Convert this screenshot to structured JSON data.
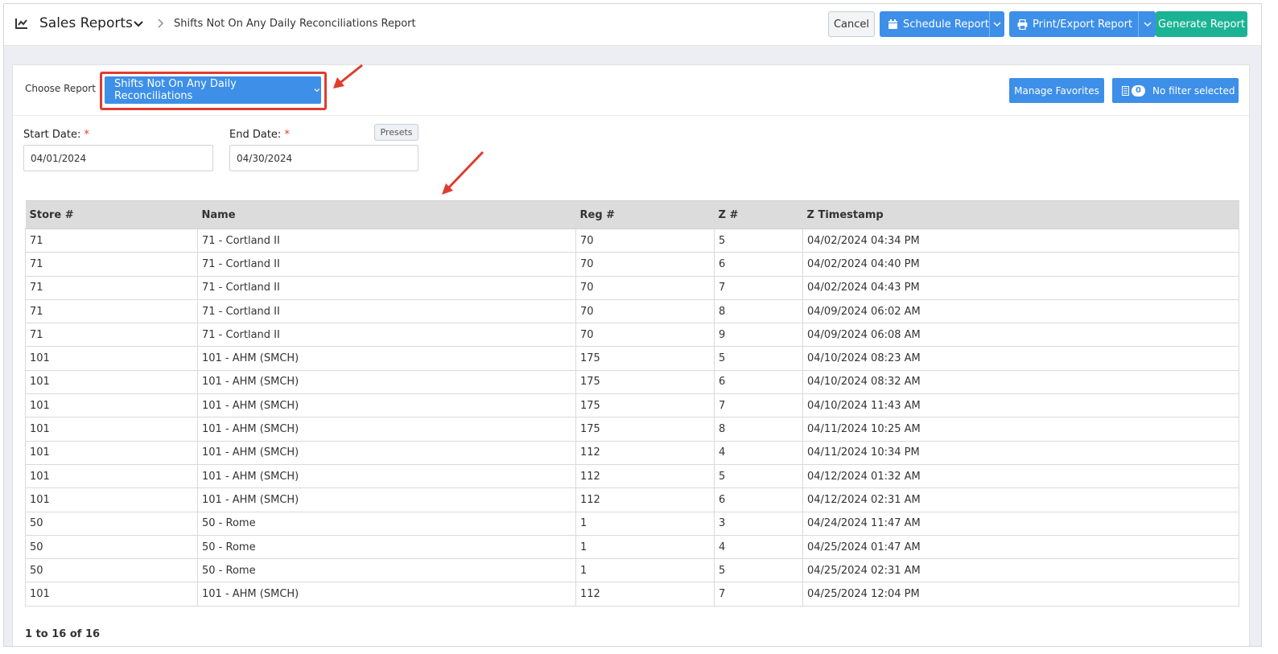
{
  "header": {
    "app_title": "Sales Reports",
    "breadcrumb": "Shifts Not On Any Daily Reconciliations Report",
    "cancel_label": "Cancel",
    "schedule_label": "Schedule Report",
    "print_label": "Print/Export Report",
    "generate_label": "Generate Report"
  },
  "controls": {
    "choose_report_label": "Choose Report",
    "selected_report": "Shifts Not On Any Daily Reconciliations",
    "manage_favorites_label": "Manage Favorites",
    "filter_count": "0",
    "filter_label": "No filter selected",
    "start_date_label": "Start Date:",
    "end_date_label": "End Date:",
    "required_mark": "*",
    "start_date_value": "04/01/2024",
    "end_date_value": "04/30/2024",
    "presets_label": "Presets"
  },
  "table": {
    "columns": [
      "Store #",
      "Name",
      "Reg #",
      "Z #",
      "Z Timestamp"
    ],
    "rows": [
      [
        "71",
        "71 - Cortland II",
        "70",
        "5",
        "04/02/2024 04:34 PM"
      ],
      [
        "71",
        "71 - Cortland II",
        "70",
        "6",
        "04/02/2024 04:40 PM"
      ],
      [
        "71",
        "71 - Cortland II",
        "70",
        "7",
        "04/02/2024 04:43 PM"
      ],
      [
        "71",
        "71 - Cortland II",
        "70",
        "8",
        "04/09/2024 06:02 AM"
      ],
      [
        "71",
        "71 - Cortland II",
        "70",
        "9",
        "04/09/2024 06:08 AM"
      ],
      [
        "101",
        "101 - AHM (SMCH)",
        "175",
        "5",
        "04/10/2024 08:23 AM"
      ],
      [
        "101",
        "101 - AHM (SMCH)",
        "175",
        "6",
        "04/10/2024 08:32 AM"
      ],
      [
        "101",
        "101 - AHM (SMCH)",
        "175",
        "7",
        "04/10/2024 11:43 AM"
      ],
      [
        "101",
        "101 - AHM (SMCH)",
        "175",
        "8",
        "04/11/2024 10:25 AM"
      ],
      [
        "101",
        "101 - AHM (SMCH)",
        "112",
        "4",
        "04/11/2024 10:34 PM"
      ],
      [
        "101",
        "101 - AHM (SMCH)",
        "112",
        "5",
        "04/12/2024 01:32 AM"
      ],
      [
        "101",
        "101 - AHM (SMCH)",
        "112",
        "6",
        "04/12/2024 02:31 AM"
      ],
      [
        "50",
        "50 - Rome",
        "1",
        "3",
        "04/24/2024 11:47 AM"
      ],
      [
        "50",
        "50 - Rome",
        "1",
        "4",
        "04/25/2024 01:47 AM"
      ],
      [
        "50",
        "50 - Rome",
        "1",
        "5",
        "04/25/2024 02:31 AM"
      ],
      [
        "101",
        "101 - AHM (SMCH)",
        "112",
        "7",
        "04/25/2024 12:04 PM"
      ]
    ]
  },
  "pager_text": "1 to 16 of 16",
  "colors": {
    "primary": "#3d8fe8",
    "success": "#1bb394",
    "annotation": "#e03c2e"
  }
}
